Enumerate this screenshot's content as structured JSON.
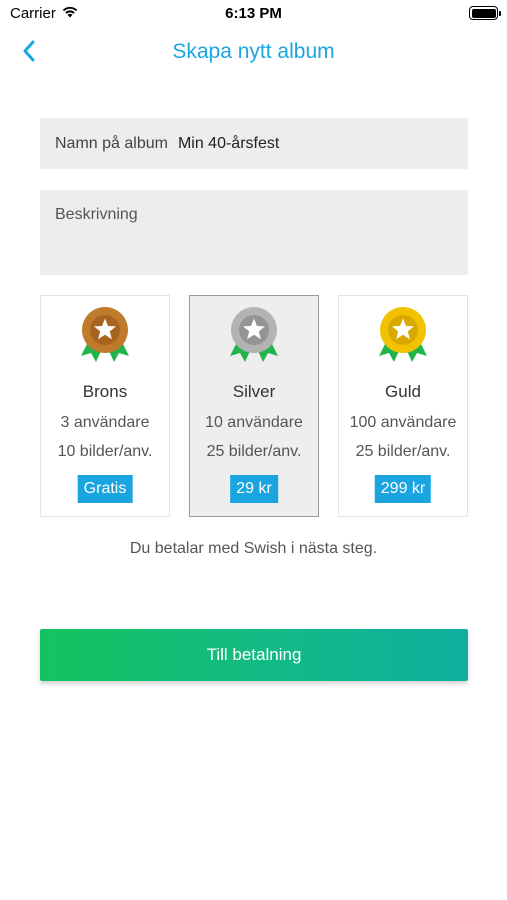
{
  "status_bar": {
    "carrier": "Carrier",
    "time": "6:13 PM"
  },
  "nav": {
    "title": "Skapa nytt album"
  },
  "form": {
    "name_label": "Namn på album",
    "name_value": "Min 40-årsfest",
    "description_placeholder": "Beskrivning"
  },
  "plans": [
    {
      "name": "Brons",
      "users": "3 användare",
      "images": "10 bilder/anv.",
      "price": "Gratis",
      "medal_color": "#c07a2c",
      "selected": false
    },
    {
      "name": "Silver",
      "users": "10 användare",
      "images": "25 bilder/anv.",
      "price": "29 kr",
      "medal_color": "#a9a9a9",
      "selected": true
    },
    {
      "name": "Guld",
      "users": "100 användare",
      "images": "25 bilder/anv.",
      "price": "299 kr",
      "medal_color": "#f2c200",
      "selected": false
    }
  ],
  "payment_note": "Du betalar med Swish i nästa steg.",
  "pay_button_label": "Till betalning",
  "colors": {
    "accent": "#1aa5e0",
    "button_start": "#16c25f",
    "button_end": "#0fae9e",
    "ribbon": "#1fb54a"
  }
}
